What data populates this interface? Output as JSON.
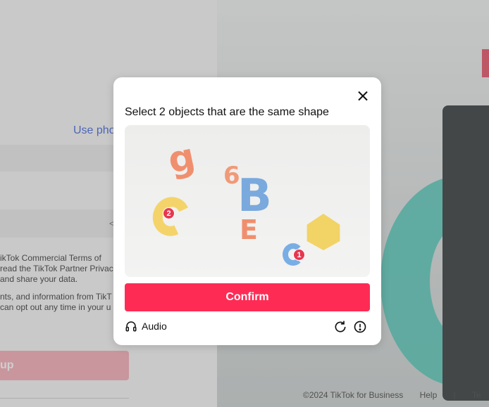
{
  "background": {
    "use_phone_text": "Use pho",
    "terms_lines": [
      "ikTok Commercial Terms of",
      " read the TikTok Partner Privac",
      "and share your data.",
      "",
      "nts, and information from TikT",
      "can opt out any time in your u"
    ],
    "signup_label": "up",
    "footer": {
      "copyright": "©2024 TikTok for Business",
      "help": "Help",
      "separator": "|",
      "extra": "Te"
    }
  },
  "modal": {
    "title": "Select 2 objects that are the same shape",
    "confirm_label": "Confirm",
    "audio_label": "Audio",
    "selections": [
      "2",
      "1"
    ],
    "objects": {
      "g_letter": "g",
      "six_digit": "6",
      "b_letter": "B",
      "e_letter": "E"
    }
  },
  "colors": {
    "accent": "#fe2c55",
    "link": "#2b56d6"
  }
}
